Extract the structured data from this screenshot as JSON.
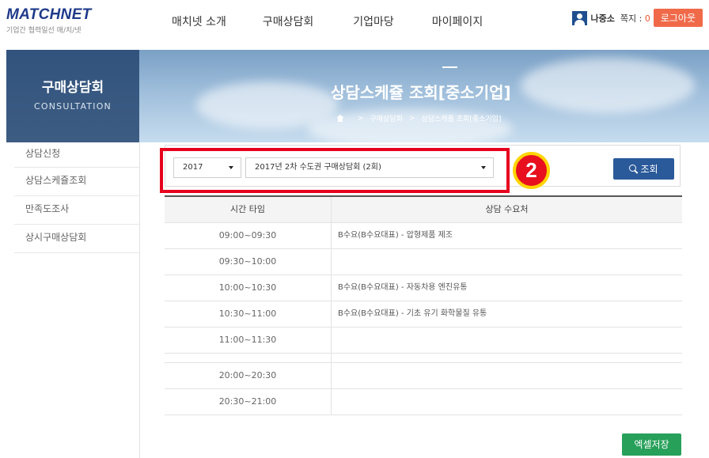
{
  "logo": {
    "name": "MATCHNET",
    "tagline": "기업간 협력일선 매/치/넷"
  },
  "nav": [
    "매치넷 소개",
    "구매상담회",
    "기업마당",
    "마이페이지"
  ],
  "user": {
    "name": "나중소",
    "message_label": "쪽지 : ",
    "message_count": "0",
    "logout_label": "로그아웃"
  },
  "banner": {
    "section_title": "구매상담회",
    "section_subtitle": "CONSULTATION",
    "page_title": "상담스케쥴 조회[중소기업]",
    "breadcrumb": [
      "구매상담회",
      "상담스케쥴 조회[중소기업]"
    ]
  },
  "sidebar": {
    "items": [
      "상담신청",
      "상담스케쥴조회",
      "만족도조사",
      "상시구매상담회"
    ]
  },
  "filters": {
    "year": "2017",
    "event": "2017년 2차 수도권 구매상담회 (2회)",
    "search_label": "조회",
    "step_badge": "2"
  },
  "table": {
    "headers": [
      "시간 타임",
      "상담 수요처"
    ],
    "rows": [
      {
        "time": "09:00~09:30",
        "buyer": "B수요(B수요대표) - 압형제품 제조"
      },
      {
        "time": "09:30~10:00",
        "buyer": ""
      },
      {
        "time": "10:00~10:30",
        "buyer": "B수요(B수요대표) - 자동차용 엔진유통"
      },
      {
        "time": "10:30~11:00",
        "buyer": "B수요(B수요대표) - 기초 유기 화학물질 유통"
      },
      {
        "time": "11:00~11:30",
        "buyer": ""
      },
      {
        "time": "20:00~20:30",
        "buyer": ""
      },
      {
        "time": "20:30~21:00",
        "buyer": ""
      }
    ]
  },
  "excel_label": "엑셀저장",
  "colors": {
    "brand": "#1f3a8a",
    "logout": "#f06a4a",
    "search": "#2a5a9a",
    "excel": "#27a05a",
    "highlight": "#e6001e"
  }
}
